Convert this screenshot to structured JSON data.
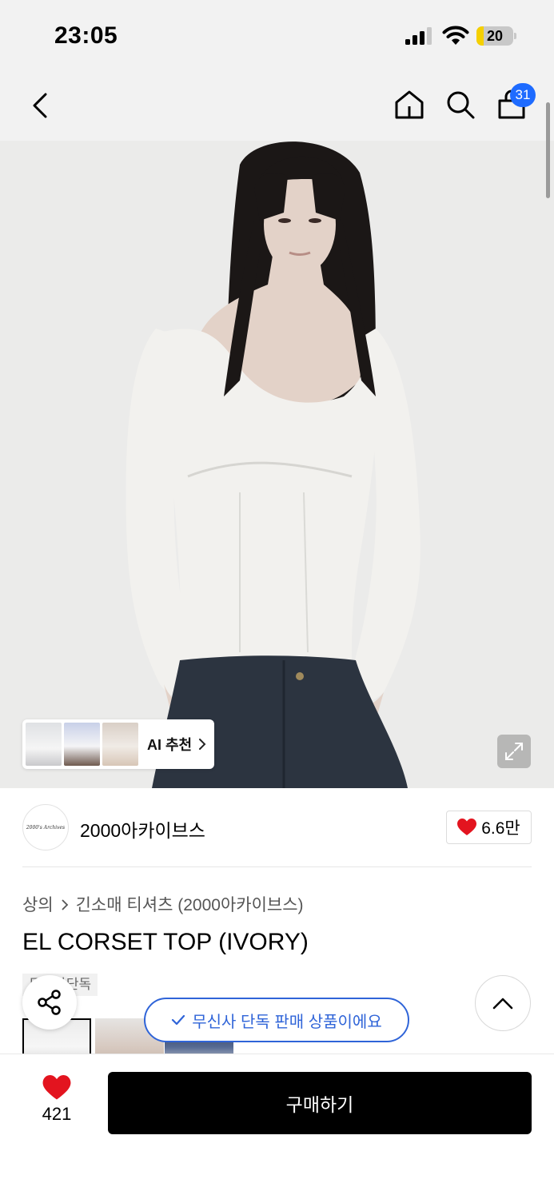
{
  "status_bar": {
    "time": "23:05",
    "battery": "20",
    "battery_level": 0.2
  },
  "nav": {
    "cart_count": "31"
  },
  "hero": {
    "ai_recommend_label": "AI 추천",
    "colors": {
      "background": "#ebebea",
      "top": "#f2f1ee",
      "hair": "#1b1716",
      "skin": "#e3d2c8",
      "denim": "#2c3440"
    }
  },
  "brand": {
    "logo_text": "2000's Archives",
    "name": "2000아카이브스",
    "like_count": "6.6만"
  },
  "breadcrumb": {
    "category": "상의",
    "subcategory": "긴소매 티셔츠 (2000아카이브스)"
  },
  "product": {
    "title": "EL CORSET TOP (IVORY)",
    "tag": "무신사단독"
  },
  "toast": {
    "exclusive_message": "무신사 단독 판매 상품이에요"
  },
  "bottom_bar": {
    "wish_count": "421",
    "buy_label": "구매하기"
  },
  "colors": {
    "accent_blue": "#2f64d8",
    "badge_blue": "#1e6bff",
    "heart_red": "#e3141f",
    "buy_button": "#000000"
  }
}
